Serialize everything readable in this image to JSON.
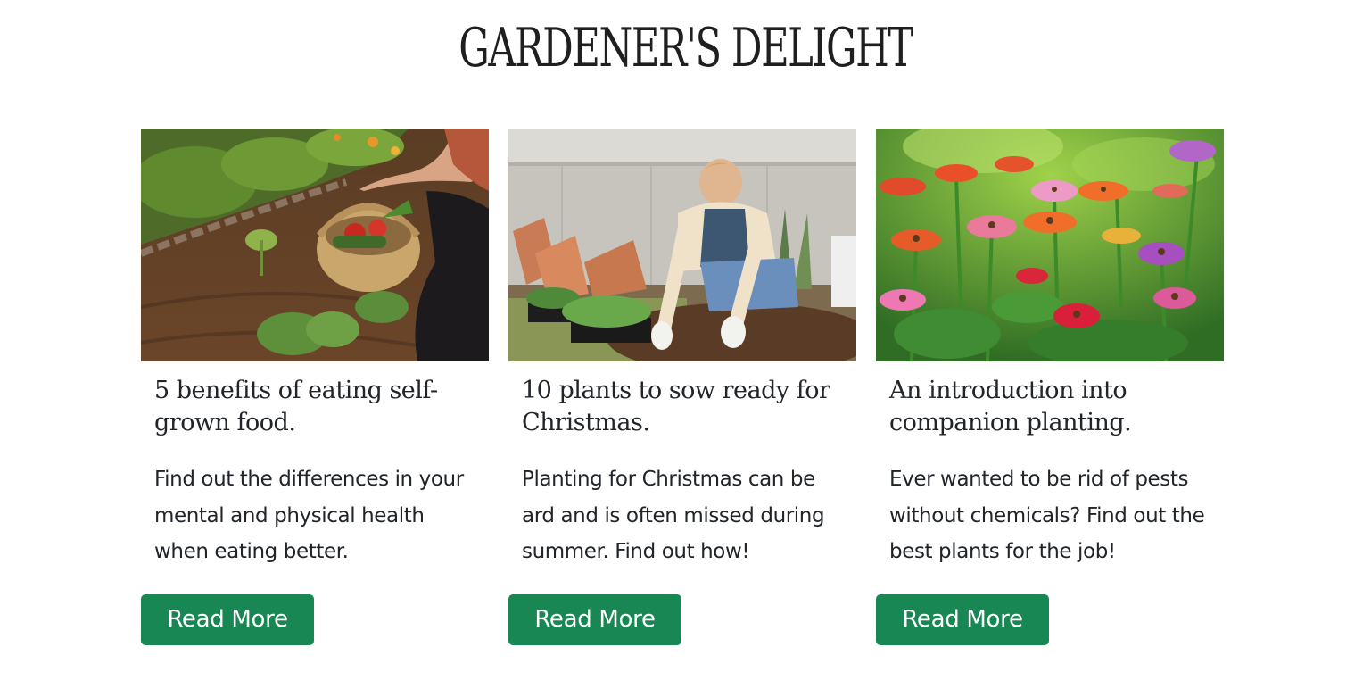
{
  "header": {
    "title": "GARDENER'S DELIGHT"
  },
  "cards": [
    {
      "image_subject": "basket of harvested vegetables in a garden bed",
      "title": "5 benefits of eating self-grown food.",
      "text": "Find out the differences in your mental and physical health when eating better.",
      "button_label": "Read More"
    },
    {
      "image_subject": "woman planting seedlings in soil",
      "title": "10 plants to sow ready for Christmas.",
      "text": "Planting for Christmas can be ard and is often missed during summer. Find out how!",
      "button_label": "Read More"
    },
    {
      "image_subject": "field of colorful zinnia flowers",
      "title": "An introduction into companion planting.",
      "text": "Ever wanted to be rid of pests without chemicals? Find out the best plants for the job!",
      "button_label": "Read More"
    }
  ],
  "colors": {
    "button": "#198754",
    "button_text": "#ffffff",
    "text": "#212529",
    "background": "#ffffff"
  }
}
